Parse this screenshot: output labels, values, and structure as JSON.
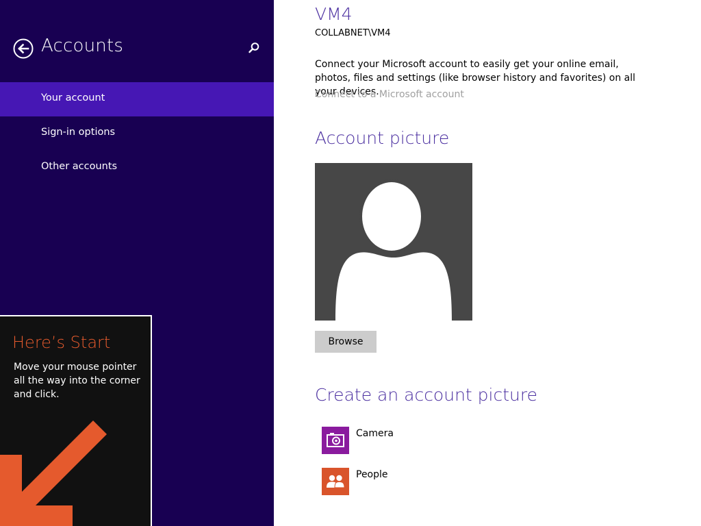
{
  "nav": {
    "title": "Accounts",
    "back_icon": "back-arrow-icon",
    "search_icon": "search-icon",
    "items": [
      {
        "label": "Your account",
        "selected": true
      },
      {
        "label": "Sign-in options",
        "selected": false
      },
      {
        "label": "Other accounts",
        "selected": false
      }
    ]
  },
  "tip": {
    "title": "Here’s Start",
    "body": "Move your mouse pointer all the way into the corner and click.",
    "arrow_icon": "corner-arrow-icon"
  },
  "account": {
    "name": "VM4",
    "domain": "COLLABNET\\VM4",
    "connect_description": "Connect your Microsoft account to easily get your online email, photos, files and settings (like browser history and favorites) on all your devices.",
    "connect_link": "Connect to a Microsoft account"
  },
  "picture": {
    "heading": "Account picture",
    "placeholder_icon": "default-user-silhouette-icon",
    "browse_label": "Browse"
  },
  "create": {
    "heading": "Create an account picture",
    "apps": [
      {
        "label": "Camera",
        "icon": "camera-icon",
        "tile_color": "#8a1b9e"
      },
      {
        "label": "People",
        "icon": "people-icon",
        "tile_color": "#d9542b"
      }
    ]
  },
  "colors": {
    "nav_background": "#180052",
    "nav_selected": "#4617b4",
    "heading_accent": "#4b2fa0",
    "tip_accent": "#e55a2d",
    "tip_background": "#111111",
    "picture_background": "#474747"
  }
}
